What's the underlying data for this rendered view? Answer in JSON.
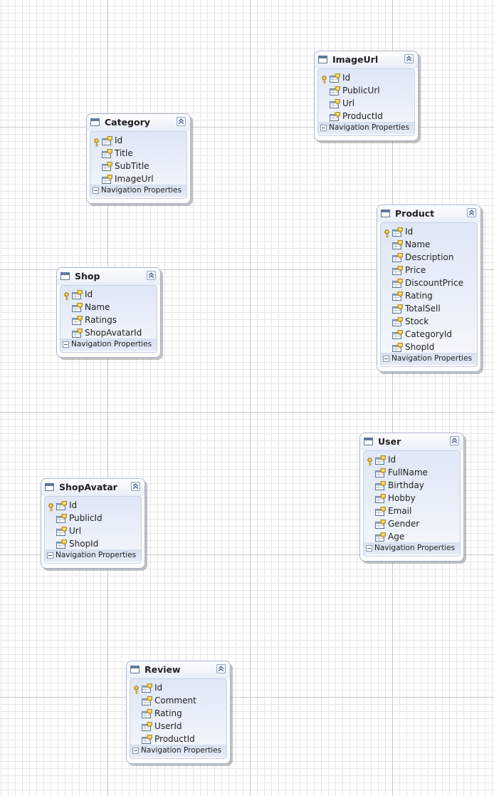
{
  "diagram": {
    "navigation_label": "Navigation Properties",
    "icons": {
      "entity": "entity-table-icon",
      "key": "key-icon",
      "property": "property-icon",
      "collapse": "collapse-chevron-icon",
      "nav_toggle": "minus-toggle-icon"
    },
    "entities": [
      {
        "id": "imageurl",
        "name": "ImageUrl",
        "properties": [
          "Id",
          "PublicUrl",
          "Url",
          "ProductId"
        ],
        "keys": [
          "Id"
        ]
      },
      {
        "id": "category",
        "name": "Category",
        "properties": [
          "Id",
          "Title",
          "SubTitle",
          "ImageUrl"
        ],
        "keys": [
          "Id"
        ]
      },
      {
        "id": "product",
        "name": "Product",
        "properties": [
          "Id",
          "Name",
          "Description",
          "Price",
          "DiscountPrice",
          "Rating",
          "TotalSell",
          "Stock",
          "CategoryId",
          "ShopId"
        ],
        "keys": [
          "Id"
        ]
      },
      {
        "id": "shop",
        "name": "Shop",
        "properties": [
          "Id",
          "Name",
          "Ratings",
          "ShopAvatarId"
        ],
        "keys": [
          "Id"
        ]
      },
      {
        "id": "user",
        "name": "User",
        "properties": [
          "Id",
          "FullName",
          "Birthday",
          "Hobby",
          "Email",
          "Gender",
          "Age"
        ],
        "keys": [
          "Id"
        ]
      },
      {
        "id": "shopavatar",
        "name": "ShopAvatar",
        "properties": [
          "Id",
          "PublicId",
          "Url",
          "ShopId"
        ],
        "keys": [
          "Id"
        ]
      },
      {
        "id": "review",
        "name": "Review",
        "properties": [
          "Id",
          "Comment",
          "Rating",
          "UserId",
          "ProductId"
        ],
        "keys": [
          "Id"
        ]
      }
    ]
  }
}
